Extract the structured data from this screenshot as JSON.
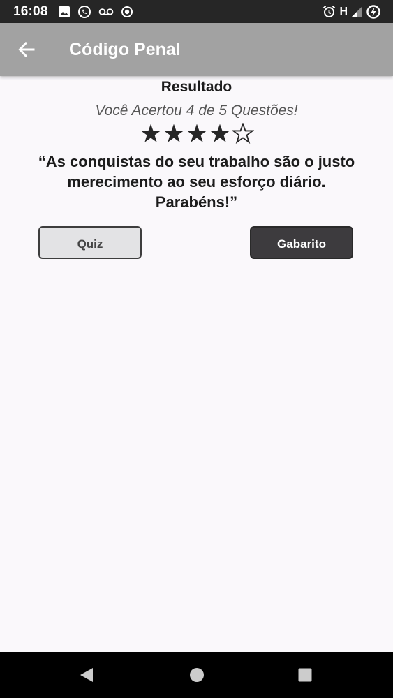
{
  "status_bar": {
    "time": "16:08",
    "network_type": "H",
    "left_icons": [
      "image-icon",
      "whatsapp-icon",
      "voicemail-icon",
      "record-icon"
    ],
    "right_icons": [
      "alarm-icon",
      "signal-icon",
      "battery-charging-icon"
    ]
  },
  "app_bar": {
    "title": "Código Penal",
    "back_icon": "arrow-left-icon",
    "background": "#a2a2a2"
  },
  "result": {
    "title": "Resultado",
    "score_text": "Você Acertou 4 de 5 Questões!",
    "rating": {
      "filled": 4,
      "total": 5
    },
    "quote": "“As conquistas do seu trabalho são o justo merecimento ao seu esforço diário. Parabéns!”"
  },
  "buttons": {
    "quiz_label": "Quiz",
    "gabarito_label": "Gabarito"
  },
  "nav_bar": {
    "icons": [
      "back-triangle-icon",
      "home-circle-icon",
      "recents-square-icon"
    ]
  },
  "colors": {
    "status_bar": "#262626",
    "page_background": "#faf8fb",
    "dark_button": "#3d3b3e",
    "light_button": "#e3e3e5"
  }
}
